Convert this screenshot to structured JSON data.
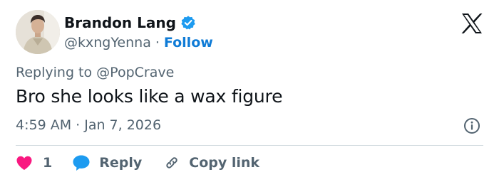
{
  "author": {
    "name": "Brandon Lang",
    "handle": "@kxngYenna",
    "separator": "·",
    "follow_label": "Follow",
    "verified_color": "#1d9bf0"
  },
  "logo": "x-logo-icon",
  "replying": {
    "prefix": "Replying to",
    "mention": "@PopCrave"
  },
  "tweet": {
    "text": "Bro she looks like a wax figure",
    "timestamp": "4:59 AM · Jan 7, 2026"
  },
  "actions": {
    "like_count": "1",
    "reply_label": "Reply",
    "copy_label": "Copy link"
  },
  "colors": {
    "like": "#f91880",
    "reply": "#1d9bf0",
    "secondary_text": "#536471",
    "follow": "#0f7bd6"
  }
}
